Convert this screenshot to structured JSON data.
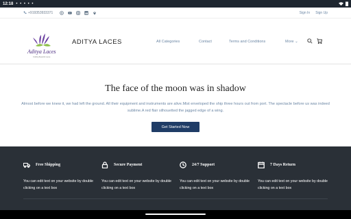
{
  "status_bar": {
    "time": "12:18",
    "dots": "• • • • •"
  },
  "topbar": {
    "phone": "+919353933371",
    "social_icons": [
      "whatsapp-icon",
      "youtube-icon",
      "instagram-icon",
      "linkedin-icon",
      "location-icon"
    ],
    "sign_in": "Sign In",
    "sign_up": "Sign Up"
  },
  "header": {
    "brand": "ADITYA LACES",
    "logo_text": "Aditya Laces",
    "logo_tagline": "Crafting Beautiful Laces",
    "nav": {
      "all_categories": "All Categories",
      "contact": "Contact",
      "terms": "Terms and Conditions",
      "more": "More"
    }
  },
  "hero": {
    "title": "The face of the moon was in shadow",
    "body": "Almost before we knew it, we had left the ground. All their equipment and instruments are alive.Mist enveloped the ship three hours out from port. The spectacle before us was indeed sublime.A red flair silhouetted the jagged edge of a wing.",
    "cta": "Get Started Now"
  },
  "features": [
    {
      "title": "Free Shipping",
      "desc": "You can edit text on your website by double clicking on a text box"
    },
    {
      "title": "Secure Payment",
      "desc": "You can edit text on your website by double clicking on a text box"
    },
    {
      "title": "24/7 Support",
      "desc": "You can edit text on your website by double clicking on a text box"
    },
    {
      "title": "7 Days Return",
      "desc": "You can edit text on your website by double clicking on a text box"
    }
  ],
  "colors": {
    "footer_bg": "#2a3037",
    "cta_bg": "#1f3c66",
    "link": "#6b86a4"
  }
}
